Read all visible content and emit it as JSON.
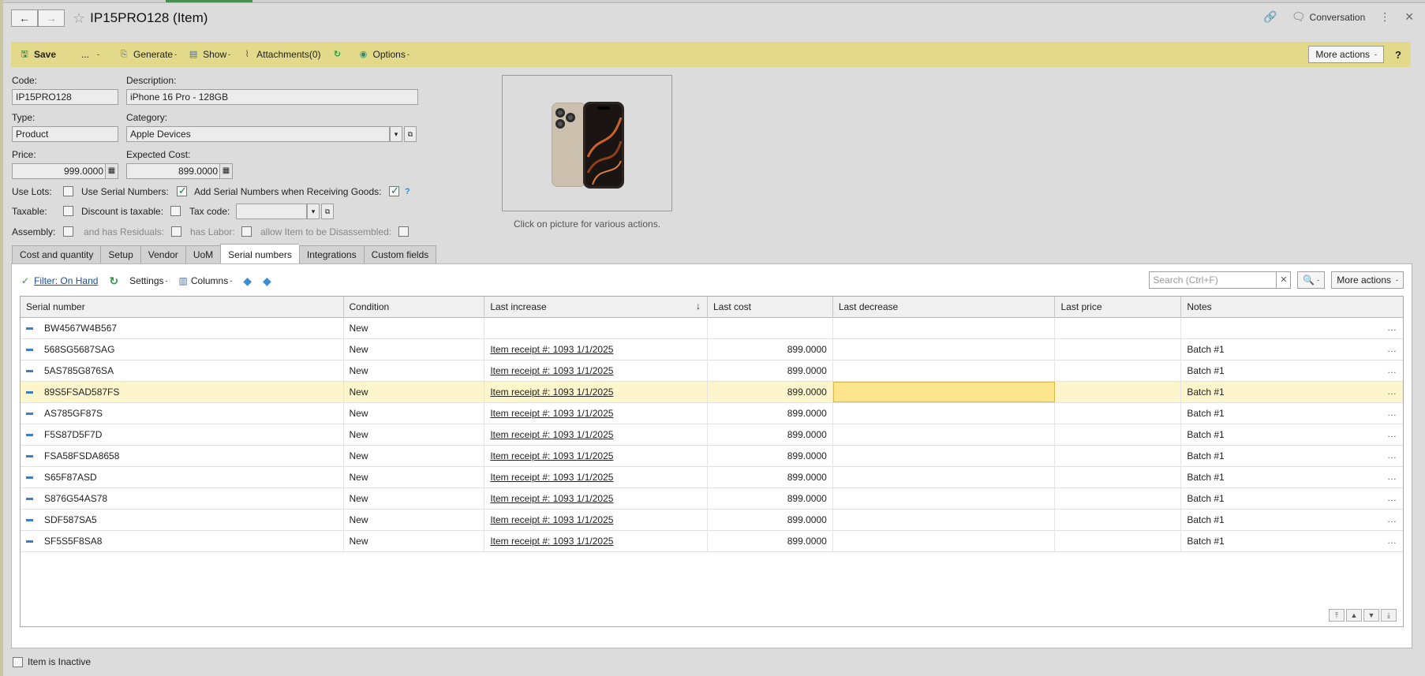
{
  "window": {
    "title": "IP15PRO128 (Item)",
    "conversation_label": "Conversation"
  },
  "toolbar": {
    "save_label": "Save",
    "dots_label": "...",
    "generate_label": "Generate",
    "show_label": "Show",
    "attachments_label": "Attachments(0)",
    "options_label": "Options",
    "more_actions_label": "More actions",
    "help_label": "?"
  },
  "form": {
    "code_label": "Code:",
    "code_value": "IP15PRO128",
    "description_label": "Description:",
    "description_value": "iPhone 16 Pro - 128GB",
    "type_label": "Type:",
    "type_value": "Product",
    "category_label": "Category:",
    "category_value": "Apple Devices",
    "price_label": "Price:",
    "price_value": "999.0000",
    "expected_cost_label": "Expected Cost:",
    "expected_cost_value": "899.0000",
    "use_lots_label": "Use Lots:",
    "use_serial_label": "Use Serial Numbers:",
    "add_serial_label": "Add Serial Numbers when Receiving Goods:",
    "help_mark": "?",
    "taxable_label": "Taxable:",
    "discount_taxable_label": "Discount is taxable:",
    "tax_code_label": "Tax code:",
    "tax_code_value": "",
    "assembly_label": "Assembly:",
    "residuals_label": "and has Residuals:",
    "labor_label": "has Labor:",
    "disassemble_label": "allow Item to be Disassembled:",
    "checkboxes": {
      "use_lots": false,
      "use_serial": true,
      "add_serial": true,
      "taxable": false,
      "discount_taxable": false,
      "assembly": false,
      "residuals": false,
      "labor": false,
      "disassemble": false
    }
  },
  "picture": {
    "caption": "Click on picture for various actions."
  },
  "tabs": [
    {
      "label": "Cost and quantity"
    },
    {
      "label": "Setup"
    },
    {
      "label": "Vendor"
    },
    {
      "label": "UoM"
    },
    {
      "label": "Serial numbers"
    },
    {
      "label": "Integrations"
    },
    {
      "label": "Custom fields"
    }
  ],
  "active_tab": "Serial numbers",
  "grid_toolbar": {
    "filter_label": "Filter: On Hand",
    "settings_label": "Settings",
    "columns_label": "Columns",
    "search_placeholder": "Search (Ctrl+F)",
    "more_actions_label": "More actions"
  },
  "grid": {
    "columns": [
      "Serial number",
      "Condition",
      "Last increase",
      "Last cost",
      "Last decrease",
      "Last price",
      "Notes"
    ],
    "rows": [
      {
        "serial": "BW4567W4B567",
        "condition": "New",
        "last_increase": "",
        "last_cost": "",
        "last_decrease": "",
        "last_price": "",
        "notes": ""
      },
      {
        "serial": "568SG5687SAG",
        "condition": "New",
        "last_increase": "Item receipt #: 1093 1/1/2025",
        "last_cost": "899.0000",
        "last_decrease": "",
        "last_price": "",
        "notes": "Batch #1"
      },
      {
        "serial": "5AS785G876SA",
        "condition": "New",
        "last_increase": "Item receipt #: 1093 1/1/2025",
        "last_cost": "899.0000",
        "last_decrease": "",
        "last_price": "",
        "notes": "Batch #1"
      },
      {
        "serial": "89S5FSAD587FS",
        "condition": "New",
        "last_increase": "Item receipt #: 1093 1/1/2025",
        "last_cost": "899.0000",
        "last_decrease": "",
        "last_price": "",
        "notes": "Batch #1"
      },
      {
        "serial": "AS785GF87S",
        "condition": "New",
        "last_increase": "Item receipt #: 1093 1/1/2025",
        "last_cost": "899.0000",
        "last_decrease": "",
        "last_price": "",
        "notes": "Batch #1"
      },
      {
        "serial": "F5S87D5F7D",
        "condition": "New",
        "last_increase": "Item receipt #: 1093 1/1/2025",
        "last_cost": "899.0000",
        "last_decrease": "",
        "last_price": "",
        "notes": "Batch #1"
      },
      {
        "serial": "FSA58FSDA8658",
        "condition": "New",
        "last_increase": "Item receipt #: 1093 1/1/2025",
        "last_cost": "899.0000",
        "last_decrease": "",
        "last_price": "",
        "notes": "Batch #1"
      },
      {
        "serial": "S65F87ASD",
        "condition": "New",
        "last_increase": "Item receipt #: 1093 1/1/2025",
        "last_cost": "899.0000",
        "last_decrease": "",
        "last_price": "",
        "notes": "Batch #1"
      },
      {
        "serial": "S876G54AS78",
        "condition": "New",
        "last_increase": "Item receipt #: 1093 1/1/2025",
        "last_cost": "899.0000",
        "last_decrease": "",
        "last_price": "",
        "notes": "Batch #1"
      },
      {
        "serial": "SDF587SA5",
        "condition": "New",
        "last_increase": "Item receipt #: 1093 1/1/2025",
        "last_cost": "899.0000",
        "last_decrease": "",
        "last_price": "",
        "notes": "Batch #1"
      },
      {
        "serial": "SF5S5F8SA8",
        "condition": "New",
        "last_increase": "Item receipt #: 1093 1/1/2025",
        "last_cost": "899.0000",
        "last_decrease": "",
        "last_price": "",
        "notes": "Batch #1"
      }
    ]
  },
  "footer": {
    "inactive_label": "Item is Inactive"
  },
  "colors": {
    "toolbar_bg": "#e3d98a",
    "selected_row": "#fdf5cc",
    "selected_cell": "#fde58e",
    "accent_blue": "#3a7fc9",
    "check_green": "#1e7a46"
  }
}
